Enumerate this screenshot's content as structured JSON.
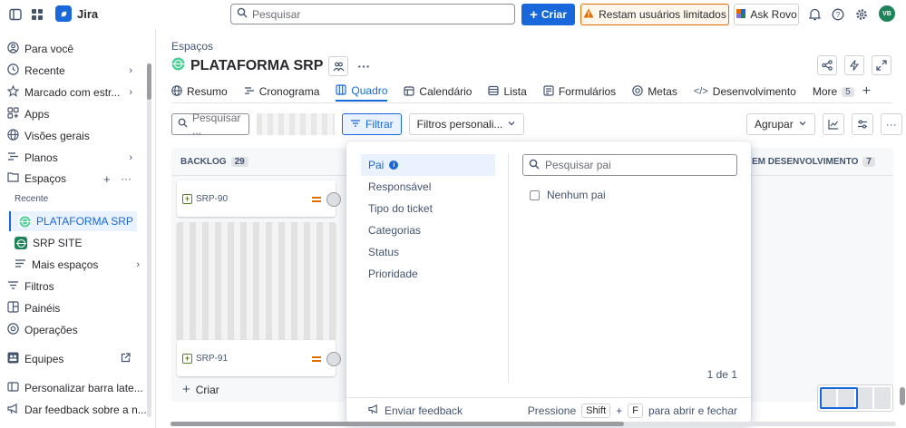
{
  "topbar": {
    "app_name": "Jira",
    "search_placeholder": "Pesquisar",
    "create_label": "Criar",
    "warning_label": "Restam usuários limitados",
    "rovo_label": "Ask Rovo",
    "avatar_initials": "VB"
  },
  "sidebar": {
    "for_you": "Para você",
    "recent": "Recente",
    "starred": "Marcado com estr...",
    "apps": "Apps",
    "overviews": "Visões gerais",
    "plans": "Planos",
    "spaces": "Espaços",
    "recent_section": "Recente",
    "project_active": "PLATAFORMA SRP",
    "project_other": "SRP SITE",
    "more_spaces": "Mais espaços",
    "filters": "Filtros",
    "dashboards": "Painéis",
    "operations": "Operações",
    "teams": "Equipes",
    "customize": "Personalizar barra late...",
    "feedback": "Dar feedback sobre a n..."
  },
  "page": {
    "breadcrumb": "Espaços",
    "title": "PLATAFORMA SRP",
    "tabs": [
      {
        "label": "Resumo"
      },
      {
        "label": "Cronograma"
      },
      {
        "label": "Quadro"
      },
      {
        "label": "Calendário"
      },
      {
        "label": "Lista"
      },
      {
        "label": "Formulários"
      },
      {
        "label": "Metas"
      },
      {
        "label": "Desenvolvimento"
      },
      {
        "label": "More"
      }
    ],
    "more_count": "5"
  },
  "toolbar": {
    "search_placeholder": "Pesquisar ...",
    "filter_label": "Filtrar",
    "custom_filters": "Filtros personali...",
    "group_label": "Agrupar"
  },
  "board": {
    "backlog_title": "BACKLOG",
    "backlog_count": "29",
    "dev_title": "EM DESENVOLVIMENTO",
    "dev_count": "7",
    "cards": [
      {
        "key": "SRP-90"
      },
      {
        "key": "SRP-91"
      }
    ],
    "create_label": "Criar"
  },
  "filter_popup": {
    "categories": [
      {
        "label": "Pai"
      },
      {
        "label": "Responsável"
      },
      {
        "label": "Tipo do ticket"
      },
      {
        "label": "Categorias"
      },
      {
        "label": "Status"
      },
      {
        "label": "Prioridade"
      }
    ],
    "search_placeholder": "Pesquisar pai",
    "option_none": "Nenhum pai",
    "pagination": "1 de 1",
    "feedback": "Enviar feedback",
    "hint_press": "Pressione",
    "hint_key1": "Shift",
    "hint_plus": "+",
    "hint_key2": "F",
    "hint_rest": "para abrir e fechar"
  },
  "colors": {
    "accent": "#1868db",
    "warning": "#e06c00",
    "story": "#5b7f24"
  }
}
